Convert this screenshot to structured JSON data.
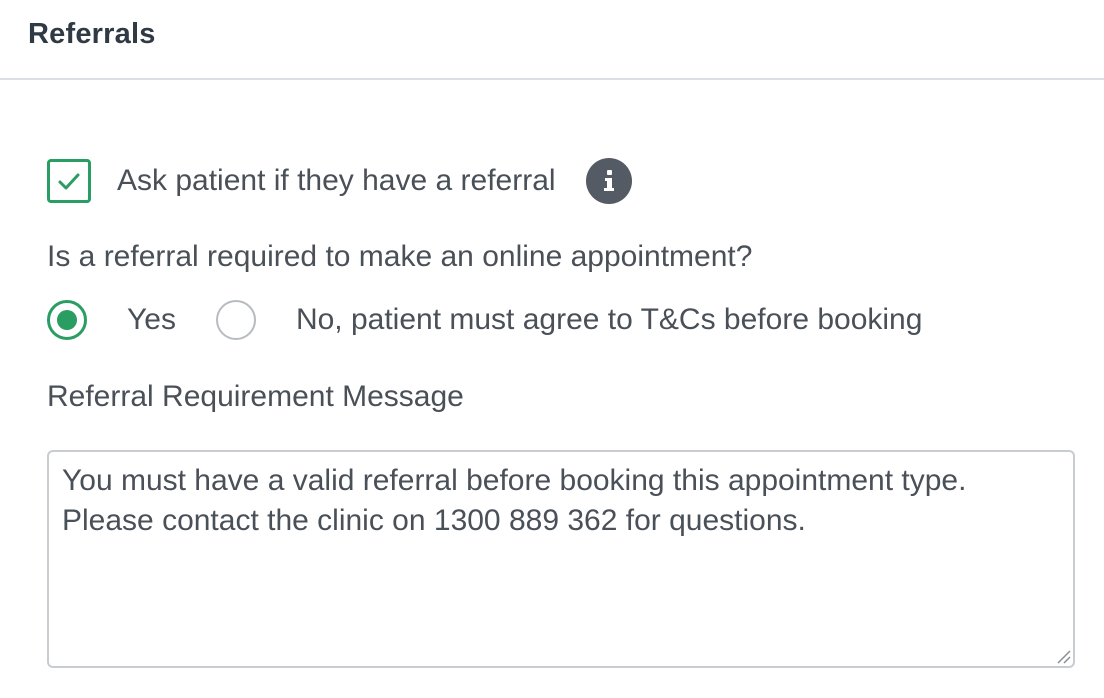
{
  "header": {
    "title": "Referrals"
  },
  "referral_check": {
    "checked": true,
    "label": "Ask patient if they have a referral",
    "info_icon": "info-icon"
  },
  "referral_required": {
    "question": "Is a referral required to make an online appointment?",
    "options": [
      {
        "label": "Yes",
        "selected": true
      },
      {
        "label": "No, patient must agree to T&Cs before booking",
        "selected": false
      }
    ]
  },
  "message": {
    "label": "Referral Requirement Message",
    "value": "You must have a valid referral before booking this appointment type.\nPlease contact the clinic on 1300 889 362 for questions."
  },
  "colors": {
    "accent": "#2a9d63",
    "text": "#4a5058",
    "border": "#c9cdd2",
    "info_icon_bg": "#555b64"
  }
}
